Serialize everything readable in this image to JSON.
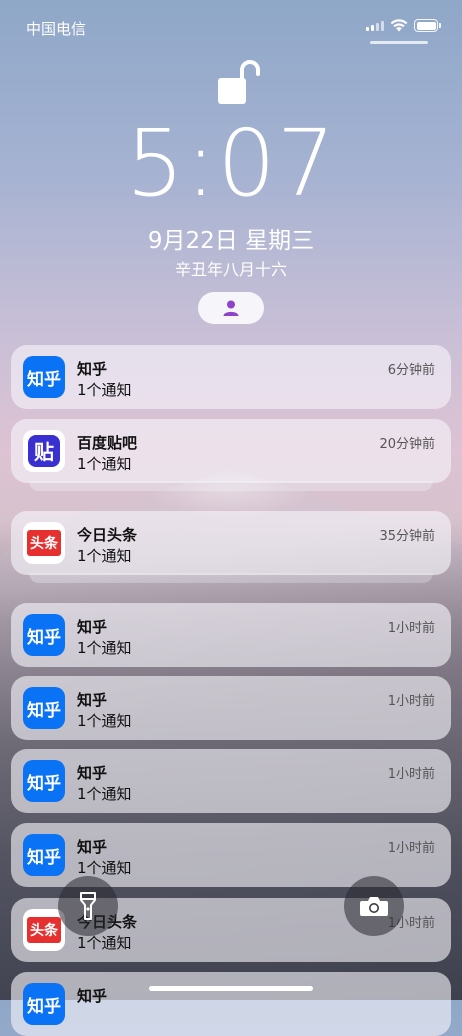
{
  "status": {
    "carrier": "中国电信"
  },
  "lockscreen": {
    "time": "5:07",
    "date": "9月22日 星期三",
    "lunar": "辛丑年八月十六"
  },
  "notifications": [
    {
      "app": "zhihu",
      "title": "知乎",
      "body": "1个通知",
      "time": "6分钟前",
      "icon_text": "知乎"
    },
    {
      "app": "tieba",
      "title": "百度贴吧",
      "body": "1个通知",
      "time": "20分钟前",
      "icon_text": "贴"
    },
    {
      "app": "toutiao",
      "title": "今日头条",
      "body": "1个通知",
      "time": "35分钟前",
      "icon_text": "头条"
    },
    {
      "app": "zhihu",
      "title": "知乎",
      "body": "1个通知",
      "time": "1小时前",
      "icon_text": "知乎"
    },
    {
      "app": "zhihu",
      "title": "知乎",
      "body": "1个通知",
      "time": "1小时前",
      "icon_text": "知乎"
    },
    {
      "app": "zhihu",
      "title": "知乎",
      "body": "1个通知",
      "time": "1小时前",
      "icon_text": "知乎"
    },
    {
      "app": "zhihu",
      "title": "知乎",
      "body": "1个通知",
      "time": "1小时前",
      "icon_text": "知乎"
    },
    {
      "app": "toutiao",
      "title": "今日头条",
      "body": "1个通知",
      "time": "1小时前",
      "icon_text": "头条"
    },
    {
      "app": "zhihu",
      "title": "知乎",
      "body": "",
      "time": "",
      "icon_text": "知乎"
    }
  ],
  "colors": {
    "zhihu_blue": "#0a72f5",
    "tieba_purple": "#3a2fd1",
    "toutiao_red": "#e63030",
    "focus_purple": "#8e44c9"
  },
  "icons": [
    "lock-open-icon",
    "person-icon",
    "flashlight-icon",
    "camera-icon",
    "wifi-icon",
    "battery-icon",
    "signal-icon"
  ]
}
